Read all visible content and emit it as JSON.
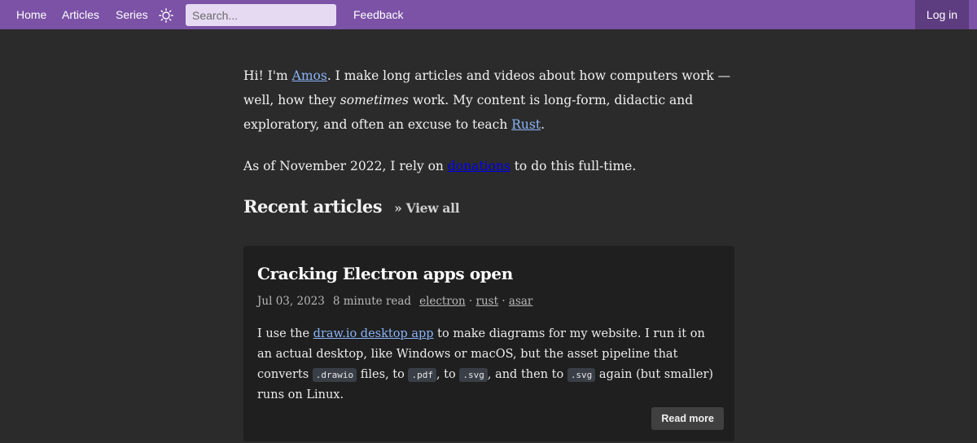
{
  "nav": {
    "home": "Home",
    "articles": "Articles",
    "series": "Series",
    "theme_icon": "sun-icon",
    "search_placeholder": "Search...",
    "search_value": "",
    "feedback": "Feedback",
    "login": "Log in"
  },
  "intro": {
    "p1_a": "Hi! I'm ",
    "author_link": "Amos",
    "p1_b": ". I make long articles and videos about how computers work — well, how they ",
    "emphasis": "sometimes",
    "p1_c": " work. My content is long-form, didactic and exploratory, and often an excuse to teach ",
    "rust_link": "Rust",
    "p1_d": ".",
    "p2_a": "As of November 2022, I rely on ",
    "donations_link": "donations",
    "p2_b": " to do this full-time."
  },
  "recent": {
    "title": "Recent articles",
    "view_all": "» View all"
  },
  "article": {
    "title": "Cracking Electron apps open",
    "date": "Jul 03, 2023",
    "read_time": "8 minute read",
    "tags": [
      "electron",
      "rust",
      "asar"
    ],
    "tag_separator": " · ",
    "excerpt_a": "I use the ",
    "excerpt_link": "draw.io desktop app",
    "excerpt_b": " to make diagrams for my website. I run it on an actual desktop, like Windows or macOS, but the asset pipeline that converts ",
    "code1": ".drawio",
    "excerpt_c": " files, to ",
    "code2": ".pdf",
    "excerpt_d": ", to ",
    "code3": ".svg",
    "excerpt_e": ", and then to ",
    "code4": ".svg",
    "excerpt_f": " again (but smaller) runs on Linux.",
    "read_more": "Read more"
  },
  "colors": {
    "nav_background": "#7b52a6",
    "login_background": "#5d3c80",
    "page_background": "#2b2b2b",
    "card_background": "#1f1f1f",
    "link": "#8ab4f8"
  }
}
